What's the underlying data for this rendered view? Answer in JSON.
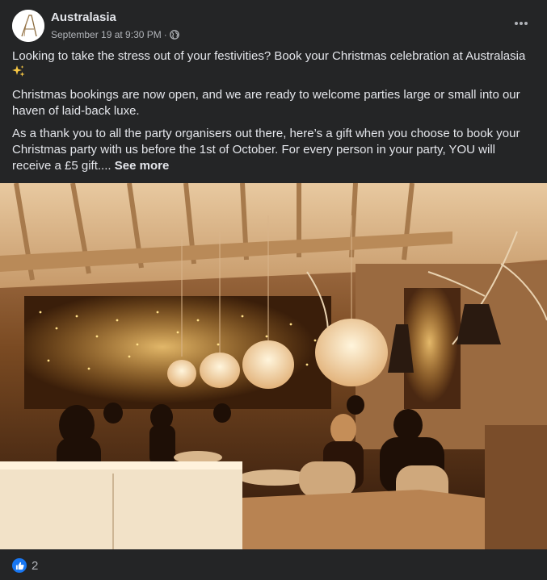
{
  "post": {
    "page_name": "Australasia",
    "timestamp": "September 19 at 9:30 PM",
    "separator": "·",
    "privacy_icon": "globe-icon",
    "options_icon": "more-options-icon",
    "paragraphs": [
      "Looking to take the stress out of your festivities? Book your Christmas celebration at Australasia",
      "Christmas bookings are now open, and we are ready to welcome parties large or small into our haven of laid-back luxe.",
      "As a thank you to all the party organisers out there, here’s a gift when you choose to book your Christmas party with us before the 1st of October. For every person in your party, YOU will receive a £5 gift...."
    ],
    "emoji": "sparkles",
    "see_more": "See more",
    "photo_icon": "restaurant-photo",
    "reactions": {
      "icon": "like-icon",
      "count": "2"
    }
  },
  "colors": {
    "card_bg": "#242526",
    "text_primary": "#e4e6eb",
    "text_secondary": "#b0b3b8",
    "like_blue": "#1877f2",
    "sparkle_gold": "#f7c744"
  }
}
